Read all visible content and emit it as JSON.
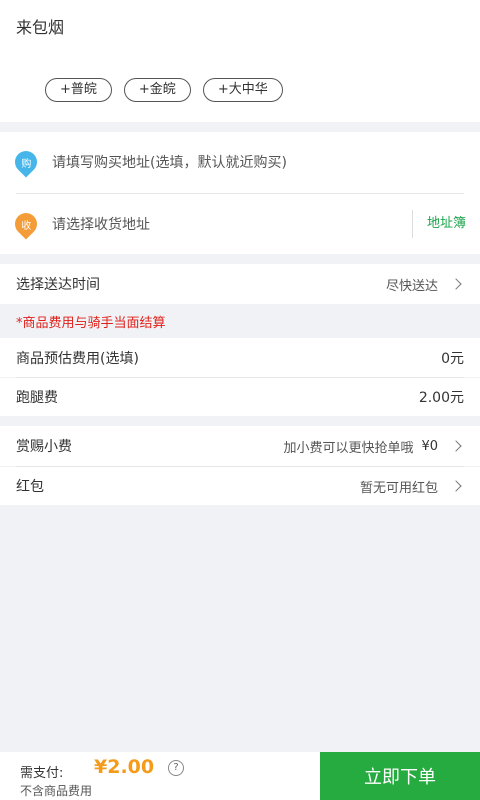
{
  "header": {
    "title": "来包烟"
  },
  "quick_items": [
    "+普皖",
    "+金皖",
    "+大中华"
  ],
  "address": {
    "purchase_icon_text": "购",
    "purchase_placeholder": "请填写购买地址(选填，默认就近购买)",
    "receive_icon_text": "收",
    "receive_placeholder": "请选择收货地址",
    "address_book_label": "地址簿"
  },
  "delivery_time": {
    "label": "选择送达时间",
    "value": "尽快送达"
  },
  "notice": "*商品费用与骑手当面结算",
  "fees": {
    "estimate_label": "商品预估费用(选填)",
    "estimate_value": "0元",
    "errand_label": "跑腿费",
    "errand_value": "2.00元"
  },
  "tip": {
    "label": "赏赐小费",
    "hint": "加小费可以更快抢单哦",
    "value": "¥0"
  },
  "red_packet": {
    "label": "红包",
    "value": "暂无可用红包"
  },
  "footer": {
    "pay_label": "需支付:",
    "pay_amount": "¥2.00",
    "help_icon_text": "?",
    "pay_sub": "不含商品费用",
    "order_button": "立即下单"
  },
  "colors": {
    "accent_green": "#25ab3f",
    "price_orange": "#f59b1c",
    "notice_red": "#e0201b"
  }
}
